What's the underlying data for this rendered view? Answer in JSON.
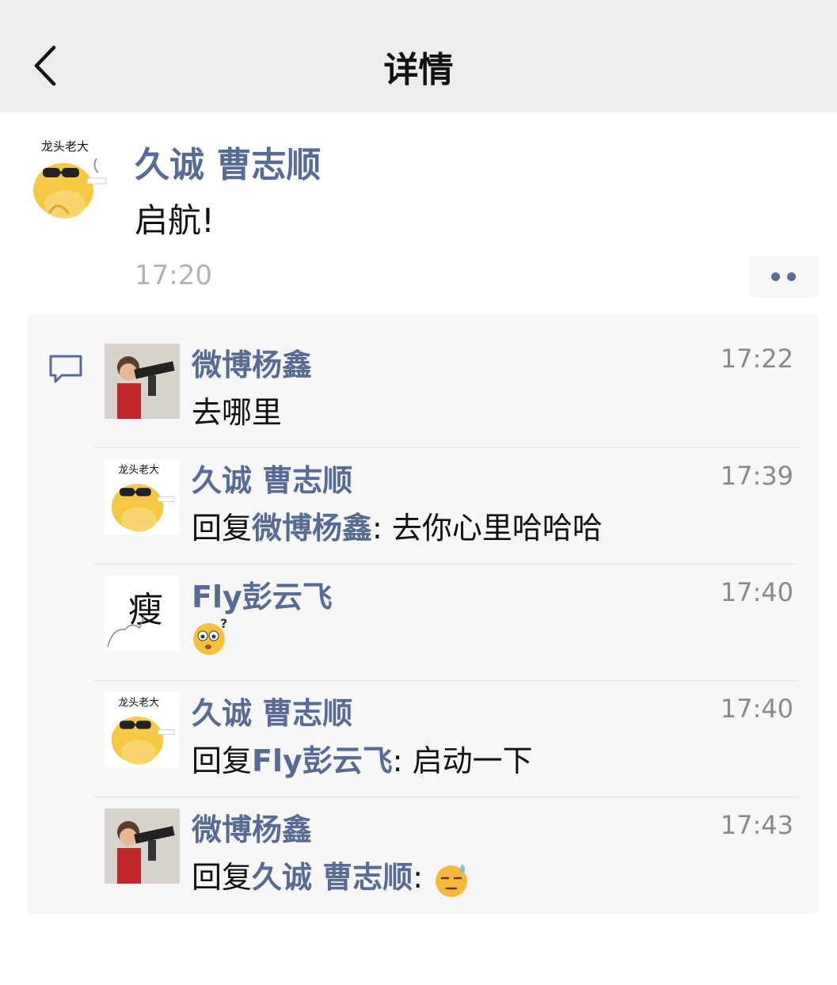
{
  "navbar": {
    "title": "详情"
  },
  "post": {
    "author": "久诚 曹志顺",
    "avatar_text": "龙头老大",
    "text": "启航!",
    "time": "17:20"
  },
  "comments": [
    {
      "author": "微博杨鑫",
      "time": "17:22",
      "text": "去哪里",
      "avatar": "kid-photo"
    },
    {
      "author": "久诚 曹志顺",
      "time": "17:39",
      "reply_prefix": "回复",
      "reply_to": "微博杨鑫",
      "text": ": 去你心里哈哈哈",
      "avatar": "dragon",
      "avatar_text": "龙头老大"
    },
    {
      "author": "Fly彭云飞",
      "time": "17:40",
      "emoji": "confused-emoji",
      "avatar": "calligraphy",
      "avatar_text": "瘦"
    },
    {
      "author": "久诚 曹志顺",
      "time": "17:40",
      "reply_prefix": "回复",
      "reply_to": "Fly彭云飞",
      "text": ": 启动一下",
      "avatar": "dragon",
      "avatar_text": "龙头老大"
    },
    {
      "author": "微博杨鑫",
      "time": "17:43",
      "reply_prefix": "回复",
      "reply_to": "久诚 曹志顺",
      "text": ":",
      "emoji": "sweat-emoji",
      "avatar": "kid-photo"
    }
  ],
  "colors": {
    "link": "#576b95",
    "navbar_bg": "#ededed",
    "comment_bg": "#f7f7f7",
    "time": "#b2b2b2"
  }
}
